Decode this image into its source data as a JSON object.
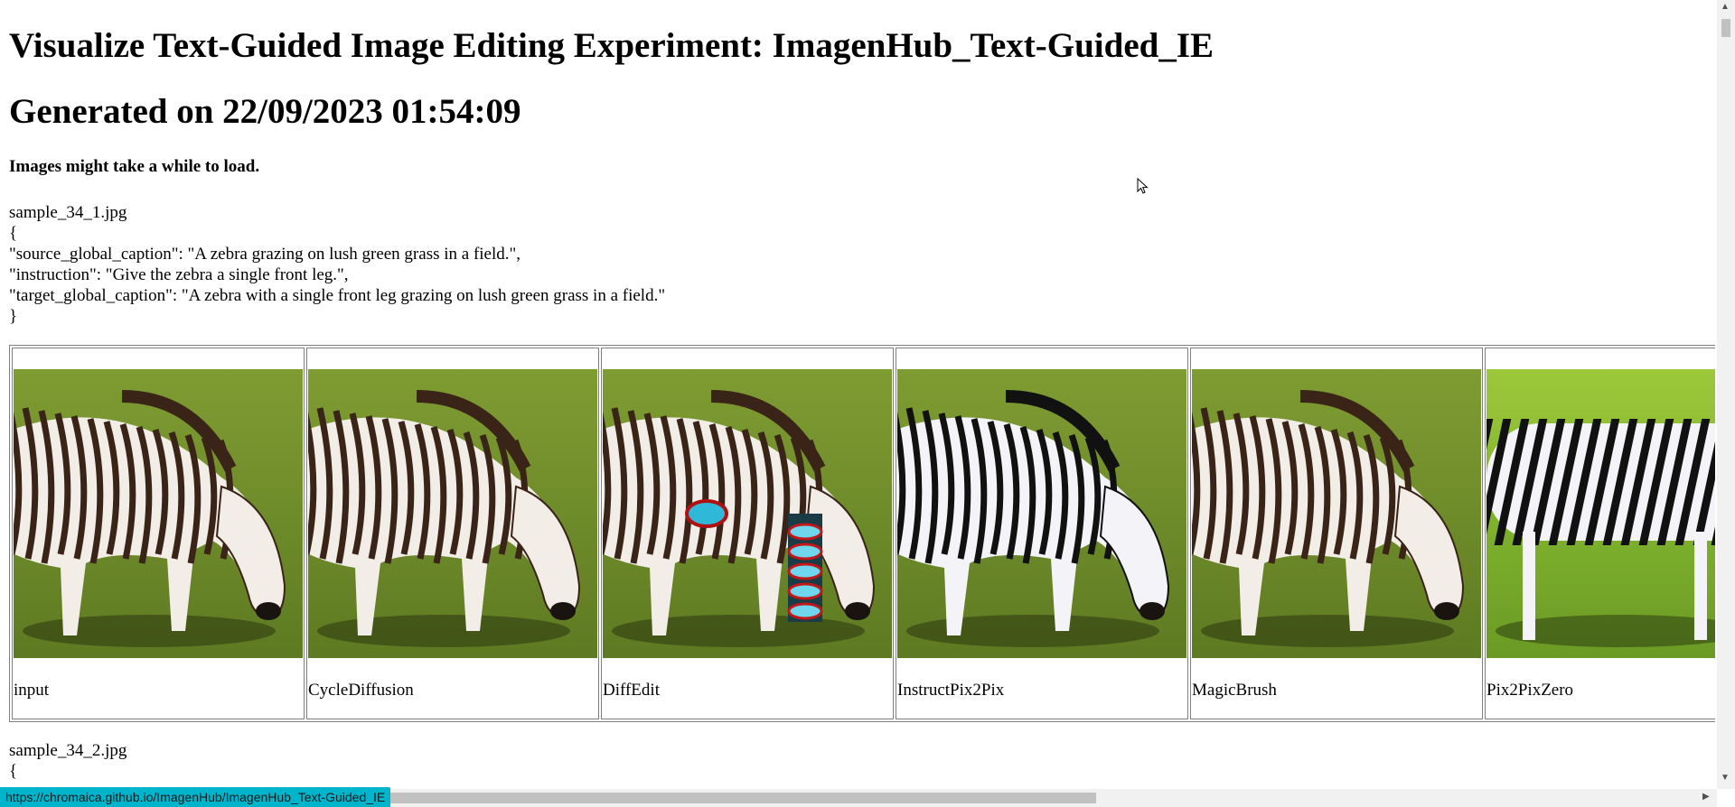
{
  "title": "Visualize Text-Guided Image Editing Experiment: ImagenHub_Text-Guided_IE",
  "subtitle": "Generated on 22/09/2023 01:54:09",
  "note": "Images might take a while to load.",
  "samples": [
    {
      "filename": "sample_34_1.jpg",
      "json_text": "{\n\"source_global_caption\": \"A zebra grazing on lush green grass in a field.\",\n\"instruction\": \"Give the zebra a single front leg.\",\n\"target_global_caption\": \"A zebra with a single front leg grazing on lush green grass in a field.\"\n}",
      "models": [
        "input",
        "CycleDiffusion",
        "DiffEdit",
        "InstructPix2Pix",
        "MagicBrush",
        "Pix2PixZero"
      ]
    },
    {
      "filename": "sample_34_2.jpg",
      "json_text": "{"
    }
  ],
  "status_url": "https://chromaica.github.io/ImagenHub/ImagenHub_Text-Guided_IE",
  "colors": {
    "status_bar": "#00b4cc",
    "grass": "#6d8a2a"
  }
}
